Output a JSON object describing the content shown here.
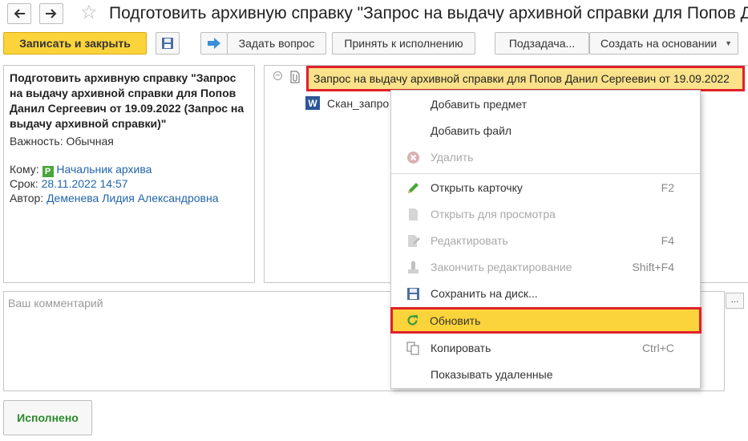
{
  "window": {
    "title": "Подготовить архивную справку \"Запрос на выдачу архивной справки для Попов Да"
  },
  "toolbar": {
    "save_close": "Записать и закрыть",
    "ask_question": "Задать вопрос",
    "accept": "Принять к исполнению",
    "subtask": "Подзадача...",
    "create_based_on": "Создать на основании"
  },
  "task": {
    "heading": "Подготовить архивную справку \"Запрос на выдачу архивной справки для Попов Данил Сергеевич от 19.09.2022 (Запрос на выдачу архивной справки)\"",
    "importance_label": "Важность:",
    "importance_value": "Обычная",
    "to_label": "Кому:",
    "to_value": "Начальник архива",
    "deadline_label": "Срок:",
    "deadline_value": "28.11.2022 14:57",
    "author_label": "Автор:",
    "author_value": "Деменева Лидия Александровна"
  },
  "tree": {
    "root": "Запрос на выдачу архивной справки для Попов Данил Сергеевич от 19.09.2022",
    "child": "Скан_запро"
  },
  "comment": {
    "placeholder": "Ваш комментарий"
  },
  "context_menu": {
    "items": [
      {
        "label": "Добавить предмет",
        "shortcut": ""
      },
      {
        "label": "Добавить файл",
        "shortcut": ""
      },
      {
        "label": "Удалить",
        "shortcut": ""
      },
      {
        "label": "Открыть карточку",
        "shortcut": "F2"
      },
      {
        "label": "Открыть для просмотра",
        "shortcut": ""
      },
      {
        "label": "Редактировать",
        "shortcut": "F4"
      },
      {
        "label": "Закончить редактирование",
        "shortcut": "Shift+F4"
      },
      {
        "label": "Сохранить на диск...",
        "shortcut": ""
      },
      {
        "label": "Обновить",
        "shortcut": ""
      },
      {
        "label": "Копировать",
        "shortcut": "Ctrl+C"
      },
      {
        "label": "Показывать удаленные",
        "shortcut": ""
      }
    ]
  },
  "footer": {
    "done": "Исполнено"
  },
  "colors": {
    "accent_yellow": "#fbd33b",
    "highlight_red": "#e0202a",
    "link_blue": "#2266aa",
    "done_green": "#2a8a2a"
  }
}
